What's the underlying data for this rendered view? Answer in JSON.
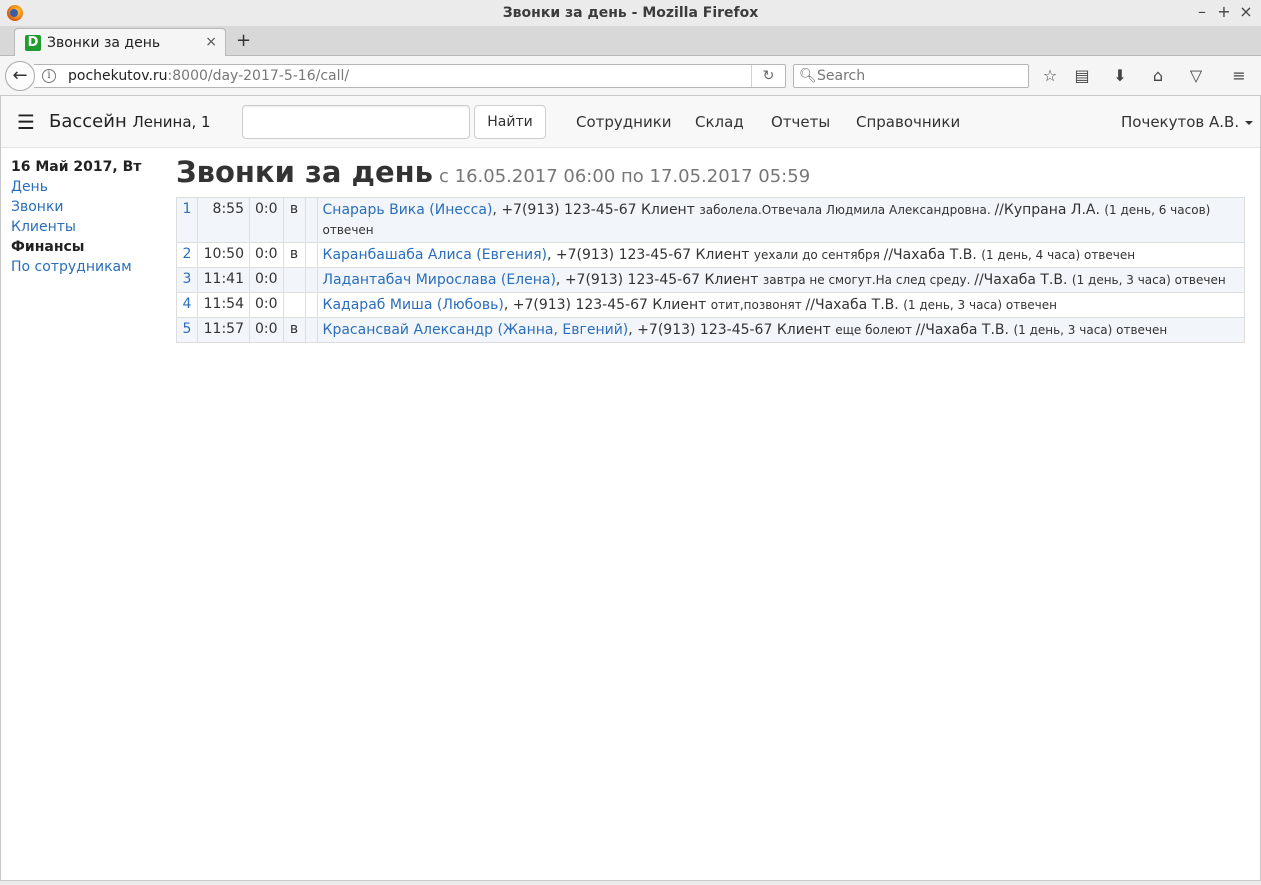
{
  "window": {
    "title": "Звонки за день - Mozilla Firefox",
    "minimize": "–",
    "maximize": "+",
    "close": "×"
  },
  "tab": {
    "favicon_letter": "D",
    "label": "Звонки за день",
    "close": "×",
    "new_tab": "+"
  },
  "navbar": {
    "url_host": "pochekutov.ru",
    "url_path": ":8000/day-2017-5-16/call/",
    "search_placeholder": "Search"
  },
  "header": {
    "brand": "Бассейн",
    "brand_sub": "Ленина, 1",
    "search_value": "",
    "find_button": "Найти",
    "nav": [
      "Сотрудники",
      "Склад",
      "Отчеты",
      "Справочники"
    ],
    "user": "Почекутов А.В."
  },
  "sidebar": {
    "date": "16 Май 2017, Вт",
    "items": [
      {
        "label": "День",
        "active": false
      },
      {
        "label": "Звонки",
        "active": false
      },
      {
        "label": "Клиенты",
        "active": false
      },
      {
        "label": "Финансы",
        "active": true
      },
      {
        "label": "По сотрудникам",
        "active": false
      }
    ]
  },
  "main": {
    "title": "Звонки за день",
    "subtitle": "с 16.05.2017 06:00 по 17.05.2017 05:59",
    "rows": [
      {
        "num": "1",
        "time": "8:55",
        "dur": "0:0",
        "dir": "в",
        "name": "Снарарь Вика (Инесса)",
        "phone": ", +7(913) 123-45-67 Клиент ",
        "note": "заболела.Отвечала Людмила Александровна. ",
        "operator": "//Купрана Л.А. ",
        "status": " (1 день, 6 часов) отвечен"
      },
      {
        "num": "2",
        "time": "10:50",
        "dur": "0:0",
        "dir": "в",
        "name": "Каранбашаба Алиса (Евгения)",
        "phone": ", +7(913) 123-45-67 Клиент ",
        "note": "уехали до сентября ",
        "operator": "//Чахаба Т.В. ",
        "status": " (1 день, 4 часа) отвечен"
      },
      {
        "num": "3",
        "time": "11:41",
        "dur": "0:0",
        "dir": "",
        "name": "Ладантабач Мирослава (Елена)",
        "phone": ", +7(913) 123-45-67 Клиент ",
        "note": "завтра не смогут.На след среду. ",
        "operator": "//Чахаба Т.В. ",
        "status": " (1 день, 3 часа) отвечен"
      },
      {
        "num": "4",
        "time": "11:54",
        "dur": "0:0",
        "dir": "",
        "name": "Кадараб Миша (Любовь)",
        "phone": ", +7(913) 123-45-67 Клиент ",
        "note": "отит,позвонят ",
        "operator": "//Чахаба Т.В. ",
        "status": " (1 день, 3 часа) отвечен"
      },
      {
        "num": "5",
        "time": "11:57",
        "dur": "0:0",
        "dir": "в",
        "name": "Красансвай Александр (Жанна, Евгений)",
        "phone": ", +7(913) 123-45-67 Клиент ",
        "note": "еще болеют ",
        "operator": "//Чахаба Т.В. ",
        "status": " (1 день, 3 часа) отвечен"
      }
    ]
  },
  "colors": {
    "link": "#2a6ebb",
    "row_alt": "#f2f6fa",
    "favicon": "#1f9c2b"
  }
}
